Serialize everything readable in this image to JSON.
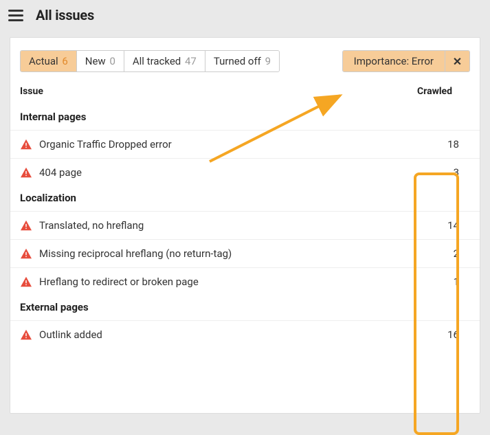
{
  "header": {
    "title": "All issues"
  },
  "tabs": [
    {
      "label": "Actual",
      "count": "6",
      "active": true
    },
    {
      "label": "New",
      "count": "0",
      "active": false
    },
    {
      "label": "All tracked",
      "count": "47",
      "active": false
    },
    {
      "label": "Turned off",
      "count": "9",
      "active": false
    }
  ],
  "filter": {
    "label": "Importance: Error"
  },
  "columns": {
    "issue": "Issue",
    "crawled": "Crawled"
  },
  "sections": [
    {
      "title": "Internal pages",
      "rows": [
        {
          "label": "Organic Traffic Dropped error",
          "value": "18"
        },
        {
          "label": "404 page",
          "value": "3"
        }
      ]
    },
    {
      "title": "Localization",
      "rows": [
        {
          "label": "Translated, no hreflang",
          "value": "14"
        },
        {
          "label": "Missing reciprocal hreflang (no return-tag)",
          "value": "2"
        },
        {
          "label": "Hreflang to redirect or broken page",
          "value": "1"
        }
      ]
    },
    {
      "title": "External pages",
      "rows": [
        {
          "label": "Outlink added",
          "value": "16"
        }
      ]
    }
  ]
}
